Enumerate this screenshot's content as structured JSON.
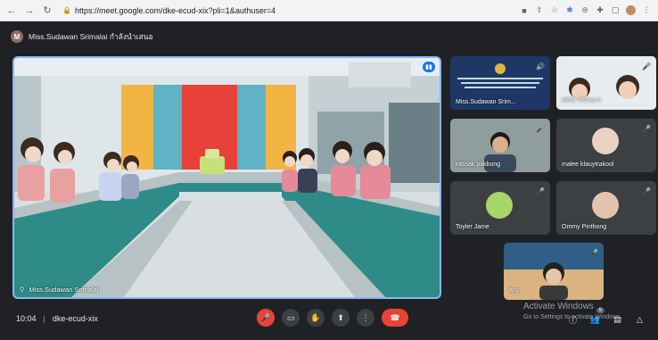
{
  "browser": {
    "url": "https://meet.google.com/dke-ecud-xix?pli=1&authuser=4",
    "lock_icon": "🔒"
  },
  "presenter": {
    "initial": "M",
    "text": "Miss.Sudawan Srimalai กำลังนำเสนอ"
  },
  "main_tile": {
    "name": "Miss.Sudawan Srimalai"
  },
  "tiles": [
    {
      "name": "Miss.Sudawan Srim...",
      "mic": ""
    },
    {
      "name": "ศศิธร ต้นทองฯ",
      "mic": "🎤"
    },
    {
      "name": "kittisak pakbung",
      "mic": "🎤"
    },
    {
      "name": "malee klauytrakool",
      "mic": "🎤"
    },
    {
      "name": "Toyler Jame",
      "mic": "🎤"
    },
    {
      "name": "Ommy Pinthong",
      "mic": "🎤"
    },
    {
      "name": "คุณ",
      "mic": "🎤"
    }
  ],
  "footer": {
    "time": "10:04",
    "separator": "|",
    "meeting_code": "dke-ecud-xix",
    "people_count": "9"
  },
  "watermark": {
    "title": "Activate Windows",
    "subtitle": "Go to Settings to activate Windows."
  },
  "colors": {
    "background": "#202124",
    "tile": "#3c4043",
    "accent_blue": "#8ab4f8",
    "end_call_red": "#ea4335"
  }
}
